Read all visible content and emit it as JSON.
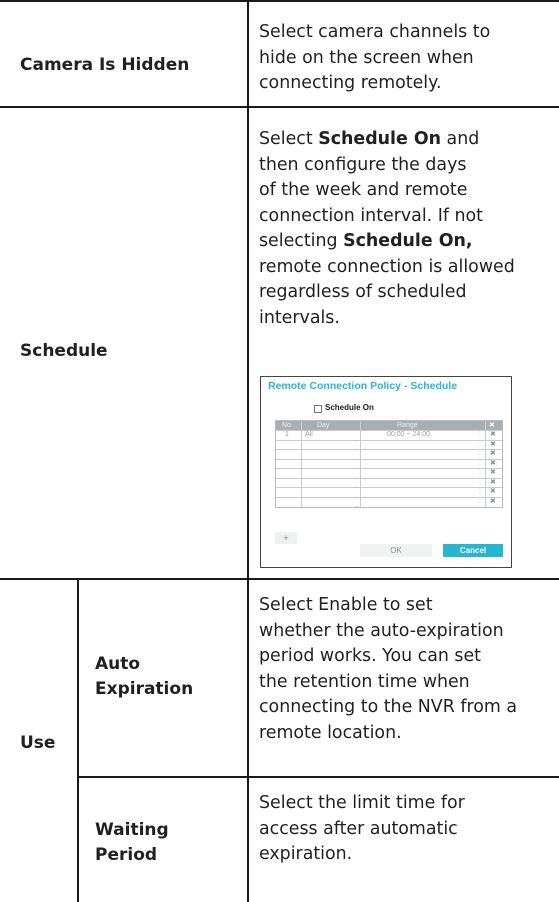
{
  "rows": {
    "camera_hidden": {
      "label": "Camera Is Hidden",
      "desc_lines": [
        "Select camera channels to",
        "hide on the screen when",
        "connecting remotely."
      ]
    },
    "schedule": {
      "label": "Schedule",
      "desc": {
        "l1_pre": "Select ",
        "l1_bold": "Schedule On",
        "l1_post": " and",
        "l2": "then configure the days",
        "l3": "of the week and remote",
        "l4": "connection interval. If not",
        "l5_pre": "selecting ",
        "l5_bold": "Schedule On,",
        "l6": "remote connection is allowed",
        "l7": "regardless of scheduled",
        "l8": "intervals."
      }
    },
    "use": {
      "label": "Use",
      "auto_expiration": {
        "label_line1": "Auto",
        "label_line2": "Expiration",
        "desc_lines": [
          "Select Enable to set",
          "whether the auto-expiration",
          "period works. You can set",
          "the retention time when",
          "connecting to the NVR from a",
          "remote location."
        ]
      },
      "waiting_period": {
        "label_line1": "Waiting",
        "label_line2": "Period",
        "desc_lines": [
          "Select the limit time for",
          "access after automatic",
          "expiration."
        ]
      }
    }
  },
  "dialog": {
    "title": "Remote Connection Policy - Schedule",
    "checkbox_label": "Schedule On",
    "checkbox_checked": false,
    "columns": [
      "No.",
      "Day",
      "Range",
      "✖"
    ],
    "rows": [
      {
        "no": "1",
        "day": "All",
        "range": "00:00 ~ 24:00"
      },
      {
        "no": "",
        "day": "",
        "range": ""
      },
      {
        "no": "",
        "day": "",
        "range": ""
      },
      {
        "no": "",
        "day": "",
        "range": ""
      },
      {
        "no": "",
        "day": "",
        "range": ""
      },
      {
        "no": "",
        "day": "",
        "range": ""
      },
      {
        "no": "",
        "day": "",
        "range": ""
      },
      {
        "no": "",
        "day": "",
        "range": ""
      }
    ],
    "delete_glyph": "✖",
    "add_label": "+",
    "ok_label": "OK",
    "cancel_label": "Cancel",
    "accent_color": "#27b5d2"
  }
}
